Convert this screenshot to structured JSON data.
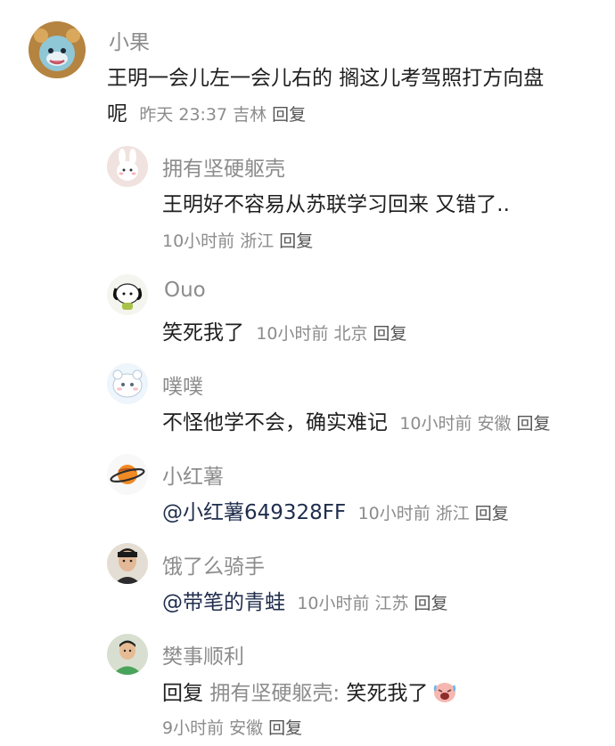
{
  "comments": [
    {
      "username": "小果",
      "text_line1": "王明一会儿左一会儿右的 搁这儿考驾照打方向盘",
      "text_line2": "呢",
      "time": "昨天 23:37",
      "location": "吉林",
      "reply_label": "回复",
      "avatar_icon": "lion-hood-cartoon-icon"
    },
    {
      "username": "拥有坚硬躯壳",
      "text": "王明好不容易从苏联学习回来 又错了..",
      "time": "10小时前",
      "location": "浙江",
      "reply_label": "回复",
      "avatar_icon": "white-bunny-icon"
    },
    {
      "username": "Ouo",
      "text": "笑死我了",
      "time": "10小时前",
      "location": "北京",
      "reply_label": "回复",
      "avatar_icon": "pochacco-dog-icon"
    },
    {
      "username": "噗噗",
      "text": "不怪他学不会，确实难记",
      "time": "10小时前",
      "location": "安徽",
      "reply_label": "回复",
      "avatar_icon": "white-cartoon-face-icon"
    },
    {
      "username": "小红薯",
      "text": "@小红薯649328FF",
      "time": "10小时前",
      "location": "浙江",
      "reply_label": "回复",
      "avatar_icon": "planet-icon"
    },
    {
      "username": "饿了么骑手",
      "text": "@带笔的青蛙",
      "time": "10小时前",
      "location": "江苏",
      "reply_label": "回复",
      "avatar_icon": "person-photo-icon"
    },
    {
      "username": "樊事顺利",
      "reply_word": "回复",
      "reply_target": "拥有坚硬躯壳:",
      "text": "笑死我了",
      "emoji_icon": "laughing-crying-face-icon",
      "time": "9小时前",
      "location": "安徽",
      "reply_label": "回复",
      "avatar_icon": "person-green-shirt-icon"
    }
  ]
}
